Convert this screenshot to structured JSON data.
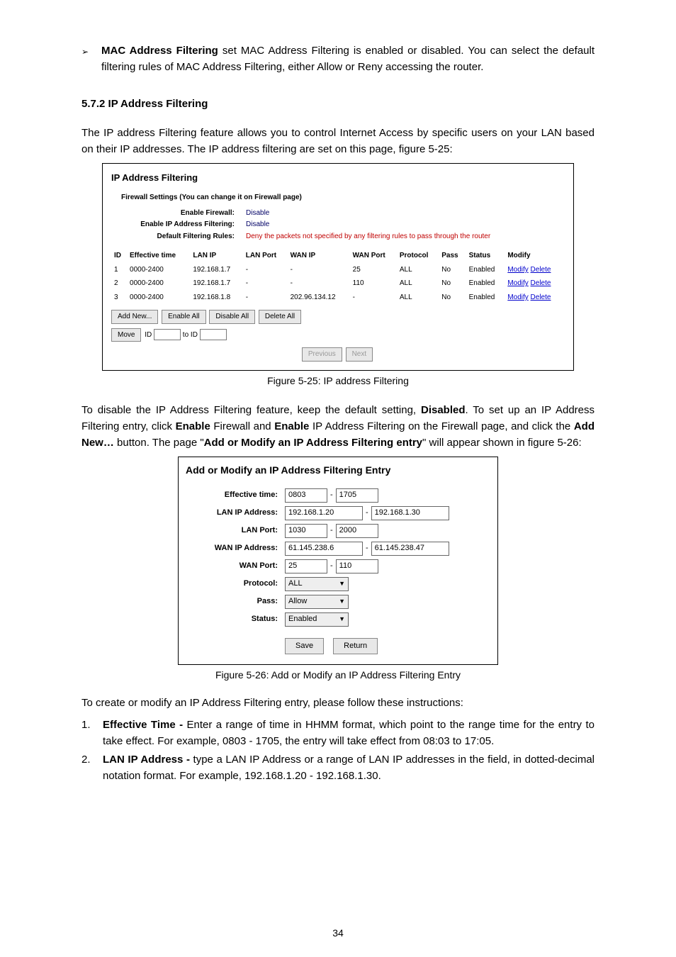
{
  "bullet_lead": "MAC Address Filtering",
  "bullet_tail": " set MAC Address Filtering is enabled or disabled. You can select the default filtering rules of MAC Address Filtering, either Allow or Reny accessing the router.",
  "section_heading": "5.7.2 IP Address Filtering",
  "intro_para": "The IP address Filtering feature allows you to control Internet Access by specific users on your LAN based on their IP addresses. The IP address filtering are set on this page, figure 5-25:",
  "fig25": {
    "title": "IP Address Filtering",
    "settings_heading": "Firewall Settings (You can change it on Firewall page)",
    "rows": [
      {
        "k": "Enable Firewall:",
        "v": "Disable",
        "cls": "on"
      },
      {
        "k": "Enable IP Address Filtering:",
        "v": "Disable",
        "cls": "on"
      },
      {
        "k": "Default Filtering Rules:",
        "v": "Deny the packets not specified by any filtering rules to pass through the router",
        "cls": "deny"
      }
    ],
    "cols": [
      "ID",
      "Effective time",
      "LAN IP",
      "LAN Port",
      "WAN IP",
      "WAN Port",
      "Protocol",
      "Pass",
      "Status",
      "Modify"
    ],
    "data": [
      [
        "1",
        "0000-2400",
        "192.168.1.7",
        "-",
        "-",
        "25",
        "ALL",
        "No",
        "Enabled"
      ],
      [
        "2",
        "0000-2400",
        "192.168.1.7",
        "-",
        "-",
        "110",
        "ALL",
        "No",
        "Enabled"
      ],
      [
        "3",
        "0000-2400",
        "192.168.1.8",
        "-",
        "202.96.134.12",
        "-",
        "ALL",
        "No",
        "Enabled"
      ]
    ],
    "modify": "Modify",
    "delete": "Delete",
    "buttons": {
      "add": "Add New...",
      "ena": "Enable All",
      "dis": "Disable All",
      "del": "Delete All",
      "move": "Move",
      "to": "to ID",
      "prev": "Previous",
      "next": "Next",
      "id": "ID"
    }
  },
  "caption25": "Figure 5-25: IP address Filtering",
  "mid": {
    "p1a": "To disable the IP Address Filtering feature, keep the default setting, ",
    "p1b": "Disabled",
    "p1c": ". To set up an IP Address Filtering entry, click ",
    "p1d": "Enable",
    "p1e": " Firewall and ",
    "p1f": "Enable",
    "p1g": " IP Address Filtering on the Firewall page, and click the ",
    "p1h": "Add New…",
    "p1i": " button. The page \"",
    "p1j": "Add or Modify an IP Address Filtering entry",
    "p1k": "\" will appear shown in figure 5-26:"
  },
  "fig26": {
    "title": "Add or Modify an IP Address Filtering Entry",
    "rows": {
      "eff": {
        "lab": "Effective time:",
        "a": "0803",
        "b": "1705"
      },
      "lanip": {
        "lab": "LAN IP Address:",
        "a": "192.168.1.20",
        "b": "192.168.1.30"
      },
      "lanport": {
        "lab": "LAN Port:",
        "a": "1030",
        "b": "2000"
      },
      "wanip": {
        "lab": "WAN IP Address:",
        "a": "61.145.238.6",
        "b": "61.145.238.47"
      },
      "wanport": {
        "lab": "WAN Port:",
        "a": "25",
        "b": "110"
      },
      "proto": {
        "lab": "Protocol:",
        "v": "ALL"
      },
      "pass": {
        "lab": "Pass:",
        "v": "Allow"
      },
      "status": {
        "lab": "Status:",
        "v": "Enabled"
      }
    },
    "save": "Save",
    "ret": "Return"
  },
  "caption26": "Figure 5-26: Add or Modify an IP Address Filtering Entry",
  "instr_lead": "To create or modify an IP Address Filtering entry, please follow these instructions:",
  "li1_bold": "Effective Time -",
  "li1": " Enter a range of time in HHMM format, which point to the range time for the entry to take effect. For example, 0803 - 1705, the entry will take effect from 08:03 to 17:05.",
  "li2_bold": "LAN IP Address -",
  "li2": " type a LAN IP Address or a range of LAN IP addresses in the field, in dotted-decimal notation format. For example, 192.168.1.20 - 192.168.1.30.",
  "n1": "1.",
  "n2": "2.",
  "pagenum": "34",
  "arrow": "➢"
}
